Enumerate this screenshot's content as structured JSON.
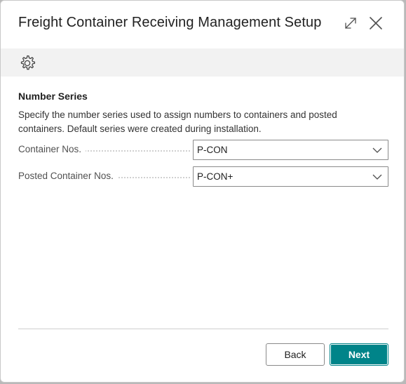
{
  "dialog": {
    "title": "Freight Container Receiving Management Setup",
    "expand_icon": "expand-icon",
    "close_icon": "close-icon"
  },
  "action_bar": {
    "settings_icon": "gear-icon"
  },
  "section": {
    "title": "Number Series",
    "description": "Specify the number series used to assign numbers to containers and posted containers. Default series were created during installation."
  },
  "fields": [
    {
      "label": "Container Nos.",
      "value": "P-CON"
    },
    {
      "label": "Posted Container Nos.",
      "value": "P-CON+"
    }
  ],
  "footer": {
    "back_label": "Back",
    "next_label": "Next"
  },
  "colors": {
    "accent": "#008489",
    "action_bar_bg": "#f2f2f2"
  }
}
